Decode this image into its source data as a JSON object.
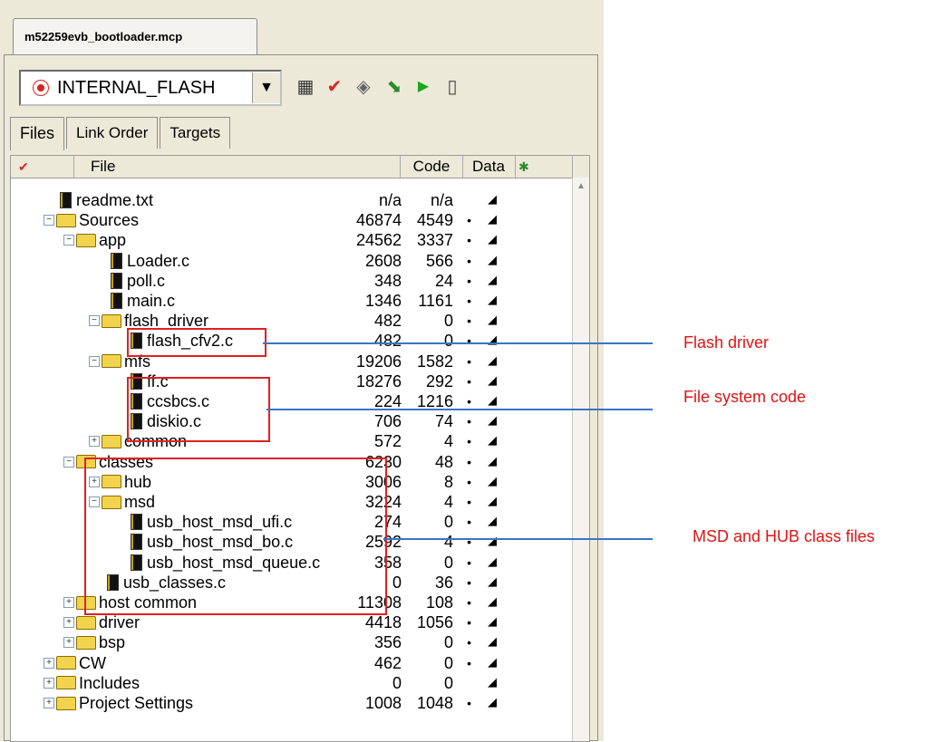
{
  "window": {
    "doc_tab": "m52259evb_bootloader.mcp"
  },
  "toolbar": {
    "target_name": "INTERNAL_FLASH",
    "target_icon": "target-red-icon",
    "icons": [
      "settings-icon",
      "check-icon",
      "debug-icon",
      "make-icon",
      "run-icon",
      "device-icon"
    ]
  },
  "tabs": [
    "Files",
    "Link Order",
    "Targets"
  ],
  "columns": {
    "file": "File",
    "code": "Code",
    "data": "Data"
  },
  "rows": [
    {
      "name": "readme.txt",
      "code": "n/a",
      "data": "n/a",
      "bullet": ""
    },
    {
      "name": "Sources",
      "code": "46874",
      "data": "4549",
      "bullet": "•"
    },
    {
      "name": "app",
      "code": "24562",
      "data": "3337",
      "bullet": "•"
    },
    {
      "name": "Loader.c",
      "code": "2608",
      "data": "566",
      "bullet": "•"
    },
    {
      "name": "poll.c",
      "code": "348",
      "data": "24",
      "bullet": "•"
    },
    {
      "name": "main.c",
      "code": "1346",
      "data": "1161",
      "bullet": "•"
    },
    {
      "name": "flash_driver",
      "code": "482",
      "data": "0",
      "bullet": "•"
    },
    {
      "name": "flash_cfv2.c",
      "code": "482",
      "data": "0",
      "bullet": "•"
    },
    {
      "name": "mfs",
      "code": "19206",
      "data": "1582",
      "bullet": "•"
    },
    {
      "name": "ff.c",
      "code": "18276",
      "data": "292",
      "bullet": "•"
    },
    {
      "name": "ccsbcs.c",
      "code": "224",
      "data": "1216",
      "bullet": "•"
    },
    {
      "name": "diskio.c",
      "code": "706",
      "data": "74",
      "bullet": "•"
    },
    {
      "name": "common",
      "code": "572",
      "data": "4",
      "bullet": "•"
    },
    {
      "name": "classes",
      "code": "6230",
      "data": "48",
      "bullet": "•"
    },
    {
      "name": "hub",
      "code": "3006",
      "data": "8",
      "bullet": "•"
    },
    {
      "name": "msd",
      "code": "3224",
      "data": "4",
      "bullet": "•"
    },
    {
      "name": "usb_host_msd_ufi.c",
      "code": "274",
      "data": "0",
      "bullet": "•"
    },
    {
      "name": "usb_host_msd_bo.c",
      "code": "2592",
      "data": "4",
      "bullet": "•"
    },
    {
      "name": "usb_host_msd_queue.c",
      "code": "358",
      "data": "0",
      "bullet": "•"
    },
    {
      "name": "usb_classes.c",
      "code": "0",
      "data": "36",
      "bullet": "•"
    },
    {
      "name": "host common",
      "code": "11308",
      "data": "108",
      "bullet": "•"
    },
    {
      "name": "driver",
      "code": "4418",
      "data": "1056",
      "bullet": "•"
    },
    {
      "name": "bsp",
      "code": "356",
      "data": "0",
      "bullet": "•"
    },
    {
      "name": "CW",
      "code": "462",
      "data": "0",
      "bullet": "•"
    },
    {
      "name": "Includes",
      "code": "0",
      "data": "0",
      "bullet": ""
    },
    {
      "name": "Project Settings",
      "code": "1008",
      "data": "1048",
      "bullet": "•"
    }
  ],
  "annotations": {
    "flash": "Flash driver",
    "fs": "File system code",
    "msd": "MSD and HUB class files",
    "color_text": "#e01414",
    "color_line": "#3c74c4"
  }
}
